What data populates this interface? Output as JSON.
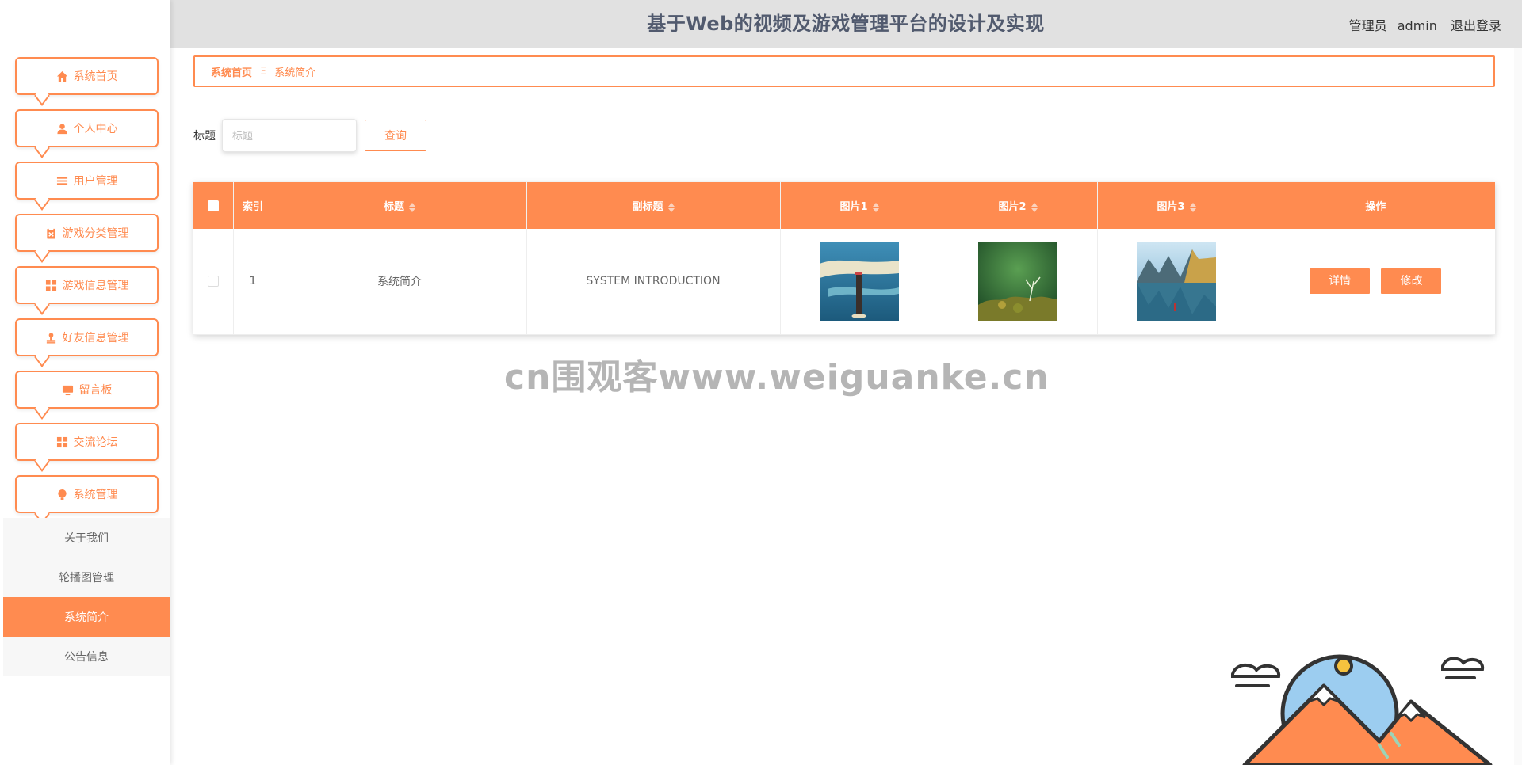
{
  "header": {
    "title": "基于Web的视频及游戏管理平台的设计及实现",
    "user_role": "管理员",
    "user_name": "admin",
    "logout_label": "退出登录"
  },
  "sidebar": {
    "items": [
      {
        "label": "系统首页",
        "icon": "home-icon"
      },
      {
        "label": "个人中心",
        "icon": "user-icon"
      },
      {
        "label": "用户管理",
        "icon": "list-icon"
      },
      {
        "label": "游戏分类管理",
        "icon": "clipboard-icon"
      },
      {
        "label": "游戏信息管理",
        "icon": "grid-icon"
      },
      {
        "label": "好友信息管理",
        "icon": "stamp-icon"
      },
      {
        "label": "留言板",
        "icon": "monitor-icon"
      },
      {
        "label": "交流论坛",
        "icon": "grid-icon"
      },
      {
        "label": "系统管理",
        "icon": "bulb-icon"
      }
    ],
    "submenu": [
      {
        "label": "关于我们"
      },
      {
        "label": "轮播图管理"
      },
      {
        "label": "系统简介"
      },
      {
        "label": "公告信息"
      }
    ]
  },
  "breadcrumb": {
    "home": "系统首页",
    "separator": "Ξ",
    "current": "系统简介"
  },
  "search": {
    "label": "标题",
    "placeholder": "标题",
    "button_label": "查询"
  },
  "table": {
    "columns": [
      "索引",
      "标题",
      "副标题",
      "图片1",
      "图片2",
      "图片3",
      "操作"
    ],
    "rows": [
      {
        "index": "1",
        "title": "系统简介",
        "subtitle": "SYSTEM INTRODUCTION",
        "detail_label": "详情",
        "edit_label": "修改"
      }
    ]
  },
  "watermark": "cn围观客www.weiguanke.cn",
  "colors": {
    "accent": "#ff8b50",
    "header_bg": "#e1e1e1",
    "title_text": "#515a6e"
  }
}
